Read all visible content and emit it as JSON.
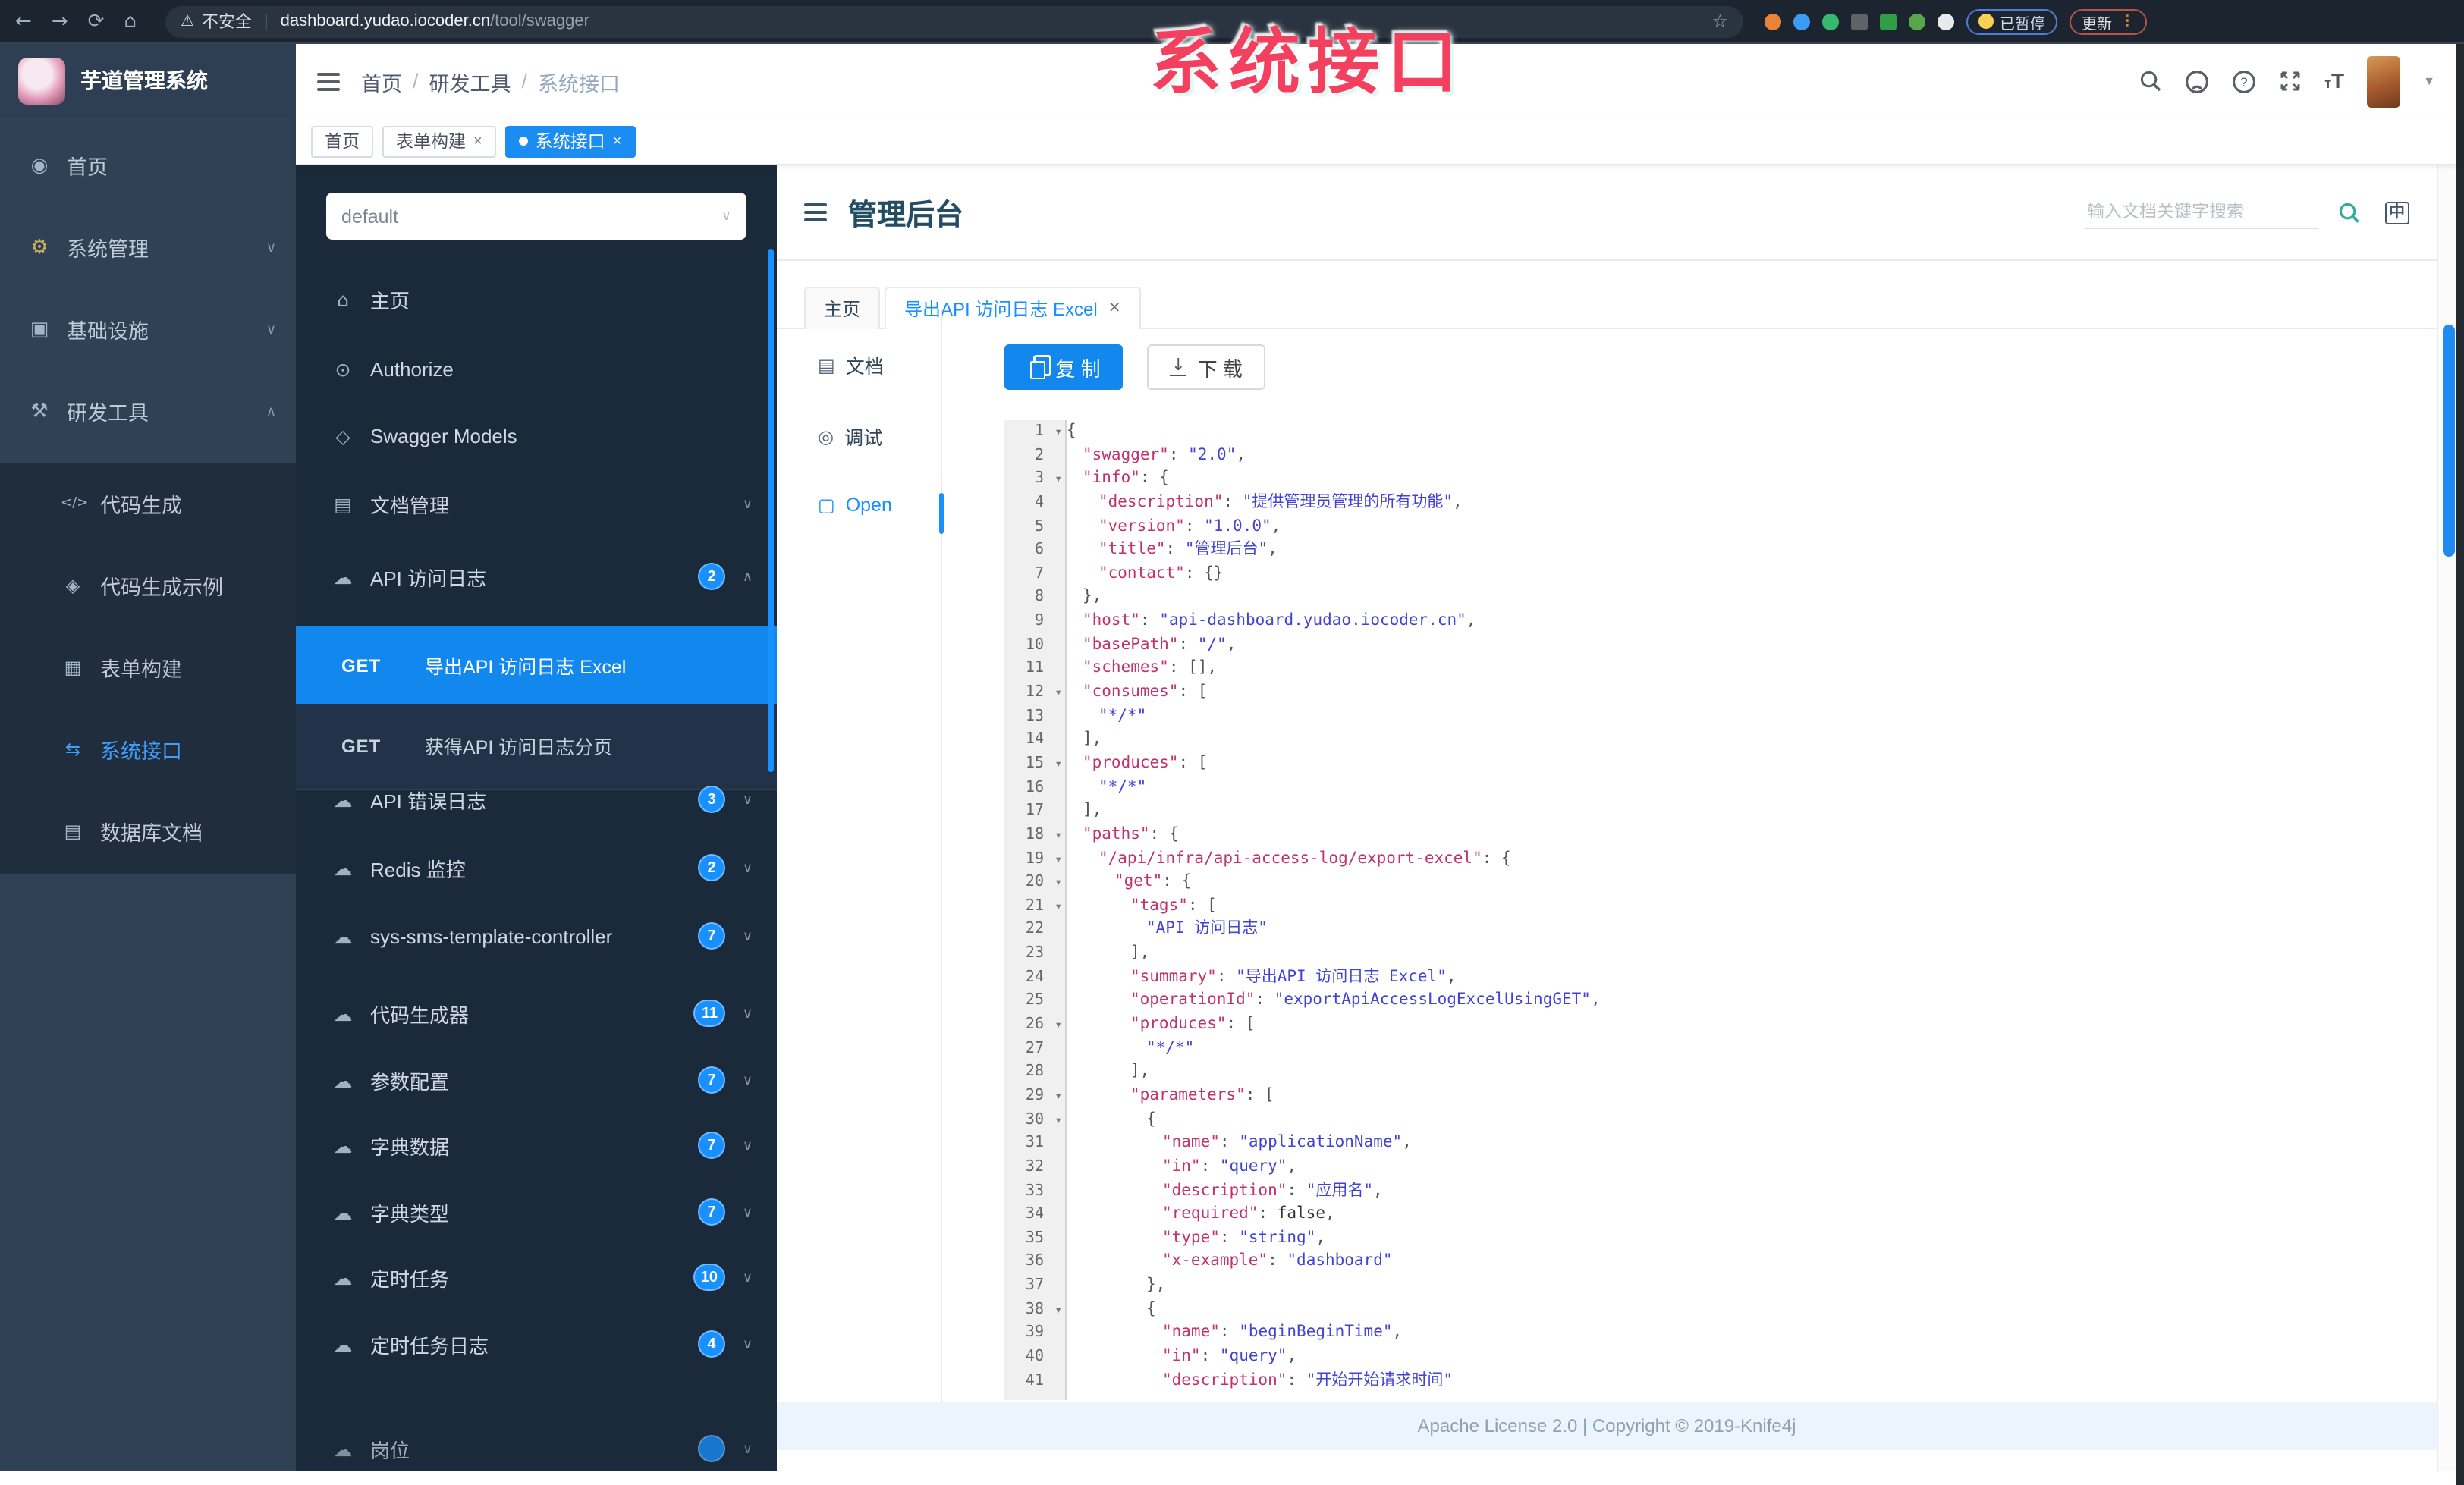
{
  "browser": {
    "security_label": "不安全",
    "url_host": "dashboard.yudao.iocoder.cn",
    "url_path": "/tool/swagger",
    "paused_label": "已暂停",
    "update_label": "更新",
    "extensions": [
      {
        "name": "ext-orange",
        "color": "#e8833a",
        "shape": "circle"
      },
      {
        "name": "ext-blue-drop",
        "color": "#3b9cf6",
        "shape": "circle"
      },
      {
        "name": "ext-green-circle",
        "color": "#35b96c",
        "shape": "circle"
      },
      {
        "name": "ext-grid",
        "color": "#5f6368",
        "shape": "square"
      },
      {
        "name": "ext-green-square",
        "color": "#2f9e44",
        "shape": "square"
      },
      {
        "name": "ext-leaf",
        "color": "#57a64a",
        "shape": "circle"
      },
      {
        "name": "ext-puzzle",
        "color": "#e8eaed",
        "shape": "circle"
      }
    ]
  },
  "watermark": "系统接口",
  "app": {
    "logo_title": "芋道管理系统",
    "breadcrumb": [
      "首页",
      "研发工具",
      "系统接口"
    ],
    "tags": [
      {
        "label": "首页",
        "closable": false,
        "active": false
      },
      {
        "label": "表单构建",
        "closable": true,
        "active": false
      },
      {
        "label": "系统接口",
        "closable": true,
        "active": true
      }
    ]
  },
  "sidebar": {
    "items": [
      {
        "label": "首页",
        "icon": "dashboard-icon"
      },
      {
        "label": "系统管理",
        "icon": "gear-icon",
        "chevron": "down"
      },
      {
        "label": "基础设施",
        "icon": "monitor-icon",
        "chevron": "down"
      },
      {
        "label": "研发工具",
        "icon": "toolbox-icon",
        "chevron": "up"
      }
    ],
    "submenu": [
      {
        "label": "代码生成",
        "icon": "code-icon",
        "active": false
      },
      {
        "label": "代码生成示例",
        "icon": "shield-icon",
        "active": false
      },
      {
        "label": "表单构建",
        "icon": "form-icon",
        "active": false
      },
      {
        "label": "系统接口",
        "icon": "api-icon",
        "active": true
      },
      {
        "label": "数据库文档",
        "icon": "table-icon",
        "active": false
      }
    ]
  },
  "swagger_nav": {
    "group_select_value": "default",
    "items_top": [
      {
        "label": "主页",
        "icon": "home-icon"
      },
      {
        "label": "Authorize",
        "icon": "lock-icon"
      },
      {
        "label": "Swagger Models",
        "icon": "hexagon-icon"
      },
      {
        "label": "文档管理",
        "icon": "doc-icon",
        "chevron": "down"
      },
      {
        "label": "API 访问日志",
        "icon": "cloud-icon",
        "badge": "2",
        "chevron": "up"
      }
    ],
    "get_children": [
      {
        "method": "GET",
        "label": "导出API 访问日志 Excel",
        "active": true
      },
      {
        "method": "GET",
        "label": "获得API 访问日志分页",
        "active": false
      }
    ],
    "items_bottom": [
      {
        "label": "API 错误日志",
        "icon": "cloud-icon",
        "badge": "3",
        "chevron": "down"
      },
      {
        "label": "Redis 监控",
        "icon": "cloud-icon",
        "badge": "2",
        "chevron": "down"
      },
      {
        "label": "sys-sms-template-controller",
        "icon": "cloud-icon",
        "badge": "7",
        "chevron": "down"
      },
      {
        "label": "代码生成器",
        "icon": "cloud-icon",
        "badge": "11",
        "chevron": "down"
      },
      {
        "label": "参数配置",
        "icon": "cloud-icon",
        "badge": "7",
        "chevron": "down"
      },
      {
        "label": "字典数据",
        "icon": "cloud-icon",
        "badge": "7",
        "chevron": "down"
      },
      {
        "label": "字典类型",
        "icon": "cloud-icon",
        "badge": "7",
        "chevron": "down"
      },
      {
        "label": "定时任务",
        "icon": "cloud-icon",
        "badge": "10",
        "chevron": "down"
      },
      {
        "label": "定时任务日志",
        "icon": "cloud-icon",
        "badge": "4",
        "chevron": "down"
      },
      {
        "label": "岗位",
        "icon": "cloud-icon",
        "badge": "",
        "chevron": "down",
        "partial": true
      }
    ]
  },
  "doc": {
    "title": "管理后台",
    "search_placeholder": "输入文档关键字搜索",
    "lang_icon_label": "中",
    "tabs": [
      {
        "label": "主页",
        "closable": false,
        "active": false
      },
      {
        "label": "导出API 访问日志 Excel",
        "closable": true,
        "active": true
      }
    ],
    "left_nav": [
      {
        "label": "文档",
        "icon": "doc-icon",
        "active": false
      },
      {
        "label": "调试",
        "icon": "debug-icon",
        "active": false
      },
      {
        "label": "Open",
        "icon": "file-icon",
        "active": true
      }
    ],
    "copy_label": "复 制",
    "download_label": "下 载",
    "footer": "Apache License 2.0 | Copyright © 2019-Knife4j"
  },
  "code": {
    "lines": [
      [
        1,
        1,
        0,
        [
          [
            "p",
            "{"
          ]
        ]
      ],
      [
        2,
        0,
        1,
        [
          [
            "k",
            "\"swagger\""
          ],
          [
            "p",
            ": "
          ],
          [
            "s",
            "\"2.0\""
          ],
          [
            "p",
            ","
          ]
        ]
      ],
      [
        3,
        1,
        1,
        [
          [
            "k",
            "\"info\""
          ],
          [
            "p",
            ": {"
          ]
        ]
      ],
      [
        4,
        0,
        2,
        [
          [
            "k",
            "\"description\""
          ],
          [
            "p",
            ": "
          ],
          [
            "s",
            "\"提供管理员管理的所有功能\""
          ],
          [
            "p",
            ","
          ]
        ]
      ],
      [
        5,
        0,
        2,
        [
          [
            "k",
            "\"version\""
          ],
          [
            "p",
            ": "
          ],
          [
            "s",
            "\"1.0.0\""
          ],
          [
            "p",
            ","
          ]
        ]
      ],
      [
        6,
        0,
        2,
        [
          [
            "k",
            "\"title\""
          ],
          [
            "p",
            ": "
          ],
          [
            "s",
            "\"管理后台\""
          ],
          [
            "p",
            ","
          ]
        ]
      ],
      [
        7,
        0,
        2,
        [
          [
            "k",
            "\"contact\""
          ],
          [
            "p",
            ": {}"
          ]
        ]
      ],
      [
        8,
        0,
        1,
        [
          [
            "p",
            "},"
          ]
        ]
      ],
      [
        9,
        0,
        1,
        [
          [
            "k",
            "\"host\""
          ],
          [
            "p",
            ": "
          ],
          [
            "s",
            "\"api-dashboard.yudao.iocoder.cn\""
          ],
          [
            "p",
            ","
          ]
        ]
      ],
      [
        10,
        0,
        1,
        [
          [
            "k",
            "\"basePath\""
          ],
          [
            "p",
            ": "
          ],
          [
            "s",
            "\"/\""
          ],
          [
            "p",
            ","
          ]
        ]
      ],
      [
        11,
        0,
        1,
        [
          [
            "k",
            "\"schemes\""
          ],
          [
            "p",
            ": [],"
          ]
        ]
      ],
      [
        12,
        1,
        1,
        [
          [
            "k",
            "\"consumes\""
          ],
          [
            "p",
            ": ["
          ]
        ]
      ],
      [
        13,
        0,
        2,
        [
          [
            "s",
            "\"*/*\""
          ]
        ]
      ],
      [
        14,
        0,
        1,
        [
          [
            "p",
            "],"
          ]
        ]
      ],
      [
        15,
        1,
        1,
        [
          [
            "k",
            "\"produces\""
          ],
          [
            "p",
            ": ["
          ]
        ]
      ],
      [
        16,
        0,
        2,
        [
          [
            "s",
            "\"*/*\""
          ]
        ]
      ],
      [
        17,
        0,
        1,
        [
          [
            "p",
            "],"
          ]
        ]
      ],
      [
        18,
        1,
        1,
        [
          [
            "k",
            "\"paths\""
          ],
          [
            "p",
            ": {"
          ]
        ]
      ],
      [
        19,
        1,
        2,
        [
          [
            "k",
            "\"/api/infra/api-access-log/export-excel\""
          ],
          [
            "p",
            ": {"
          ]
        ]
      ],
      [
        20,
        1,
        3,
        [
          [
            "k",
            "\"get\""
          ],
          [
            "p",
            ": {"
          ]
        ]
      ],
      [
        21,
        1,
        4,
        [
          [
            "k",
            "\"tags\""
          ],
          [
            "p",
            ": ["
          ]
        ]
      ],
      [
        22,
        0,
        5,
        [
          [
            "s",
            "\"API 访问日志\""
          ]
        ]
      ],
      [
        23,
        0,
        4,
        [
          [
            "p",
            "],"
          ]
        ]
      ],
      [
        24,
        0,
        4,
        [
          [
            "k",
            "\"summary\""
          ],
          [
            "p",
            ": "
          ],
          [
            "s",
            "\"导出API 访问日志 Excel\""
          ],
          [
            "p",
            ","
          ]
        ]
      ],
      [
        25,
        0,
        4,
        [
          [
            "k",
            "\"operationId\""
          ],
          [
            "p",
            ": "
          ],
          [
            "s",
            "\"exportApiAccessLogExcelUsingGET\""
          ],
          [
            "p",
            ","
          ]
        ]
      ],
      [
        26,
        1,
        4,
        [
          [
            "k",
            "\"produces\""
          ],
          [
            "p",
            ": ["
          ]
        ]
      ],
      [
        27,
        0,
        5,
        [
          [
            "s",
            "\"*/*\""
          ]
        ]
      ],
      [
        28,
        0,
        4,
        [
          [
            "p",
            "],"
          ]
        ]
      ],
      [
        29,
        1,
        4,
        [
          [
            "k",
            "\"parameters\""
          ],
          [
            "p",
            ": ["
          ]
        ]
      ],
      [
        30,
        1,
        5,
        [
          [
            "p",
            "{"
          ]
        ]
      ],
      [
        31,
        0,
        6,
        [
          [
            "k",
            "\"name\""
          ],
          [
            "p",
            ": "
          ],
          [
            "s",
            "\"applicationName\""
          ],
          [
            "p",
            ","
          ]
        ]
      ],
      [
        32,
        0,
        6,
        [
          [
            "k",
            "\"in\""
          ],
          [
            "p",
            ": "
          ],
          [
            "s",
            "\"query\""
          ],
          [
            "p",
            ","
          ]
        ]
      ],
      [
        33,
        0,
        6,
        [
          [
            "k",
            "\"description\""
          ],
          [
            "p",
            ": "
          ],
          [
            "s",
            "\"应用名\""
          ],
          [
            "p",
            ","
          ]
        ]
      ],
      [
        34,
        0,
        6,
        [
          [
            "k",
            "\"required\""
          ],
          [
            "p",
            ": "
          ],
          [
            "b",
            "false"
          ],
          [
            "p",
            ","
          ]
        ]
      ],
      [
        35,
        0,
        6,
        [
          [
            "k",
            "\"type\""
          ],
          [
            "p",
            ": "
          ],
          [
            "s",
            "\"string\""
          ],
          [
            "p",
            ","
          ]
        ]
      ],
      [
        36,
        0,
        6,
        [
          [
            "k",
            "\"x-example\""
          ],
          [
            "p",
            ": "
          ],
          [
            "s",
            "\"dashboard\""
          ]
        ]
      ],
      [
        37,
        0,
        5,
        [
          [
            "p",
            "},"
          ]
        ]
      ],
      [
        38,
        1,
        5,
        [
          [
            "p",
            "{"
          ]
        ]
      ],
      [
        39,
        0,
        6,
        [
          [
            "k",
            "\"name\""
          ],
          [
            "p",
            ": "
          ],
          [
            "s",
            "\"beginBeginTime\""
          ],
          [
            "p",
            ","
          ]
        ]
      ],
      [
        40,
        0,
        6,
        [
          [
            "k",
            "\"in\""
          ],
          [
            "p",
            ": "
          ],
          [
            "s",
            "\"query\""
          ],
          [
            "p",
            ","
          ]
        ]
      ],
      [
        41,
        0,
        6,
        [
          [
            "k",
            "\"description\""
          ],
          [
            "p",
            ": "
          ],
          [
            "s",
            "\"开始开始请求时间\""
          ]
        ]
      ]
    ]
  }
}
